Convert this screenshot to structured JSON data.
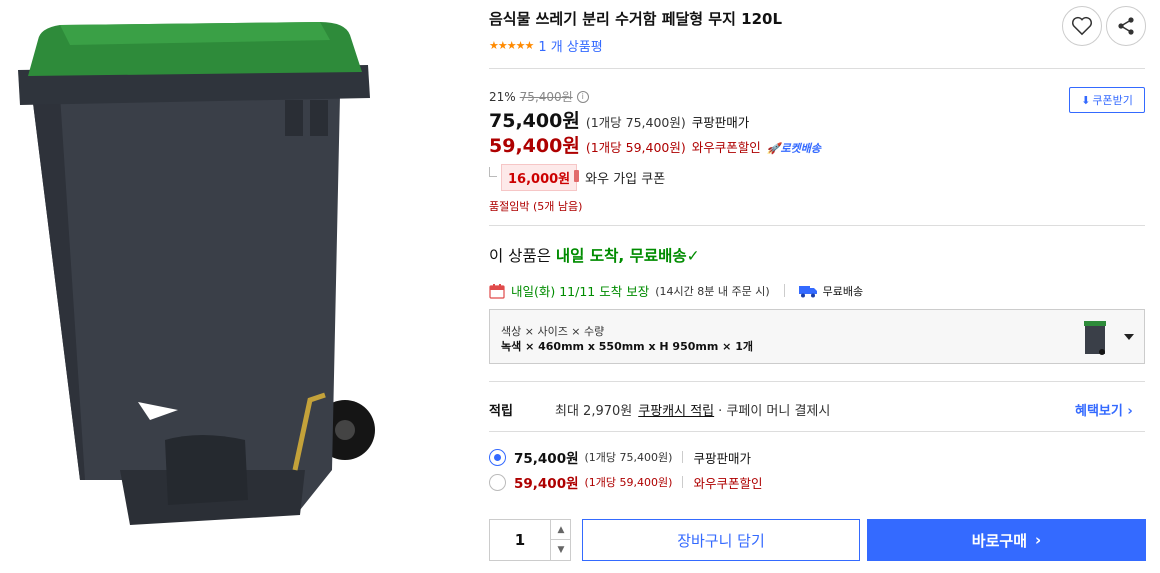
{
  "product": {
    "title": "음식물 쓰레기 분리 수거함 페달형 무지 120L",
    "stars": "★★★★★",
    "review_count": "1 개 상품평",
    "rating": 5
  },
  "actions": {
    "wishlist_icon": "heart-icon",
    "share_icon": "share-icon",
    "coupon_download": "쿠폰받기"
  },
  "pricing": {
    "discount_rate": "21%",
    "original_price": "75,400원",
    "sale_price": "75,400원",
    "sale_unit": "(1개당 75,400원)",
    "sale_label": "쿠팡판매가",
    "wow_price": "59,400원",
    "wow_unit": "(1개당 59,400원)",
    "wow_label": "와우쿠폰할인",
    "rocket_label": "로켓배송",
    "wow_coupon_amount": "16,000원",
    "wow_coupon_label": "와우 가입 쿠폰",
    "stock_warning": "품절임박 (5개 남음)"
  },
  "delivery": {
    "headline_prefix": "이 상품은",
    "headline_highlight": "내일 도착, 무료배송",
    "arrival_date": "내일(화) 11/11 도착 보장",
    "arrival_note": "(14시간 8분 내 주문 시)",
    "free_shipping": "무료배송"
  },
  "option": {
    "labels": "색상 × 사이즈 × 수량",
    "selected": "녹색 × 460mm x 550mm x H 950mm × 1개"
  },
  "reward": {
    "label": "적립",
    "max_points": "최대 2,970원",
    "cash_link": "쿠팡캐시 적립",
    "rest": "· 쿠페이 머니 결제시",
    "benefit_link": "혜택보기 ›"
  },
  "price_options": [
    {
      "price": "75,400원",
      "unit": "(1개당 75,400원)",
      "label": "쿠팡판매가",
      "selected": true
    },
    {
      "price": "59,400원",
      "unit": "(1개당 59,400원)",
      "label": "와우쿠폰할인",
      "selected": false
    }
  ],
  "purchase": {
    "quantity": "1",
    "cart_button": "장바구니 담기",
    "buy_button": "바로구매",
    "buy_arrow": "›"
  },
  "colors": {
    "accent": "#346aff",
    "wow_red": "#ae0000",
    "arrival_green": "#008c00",
    "bin_body": "#3a3f48",
    "bin_lid": "#2e8b3a"
  }
}
